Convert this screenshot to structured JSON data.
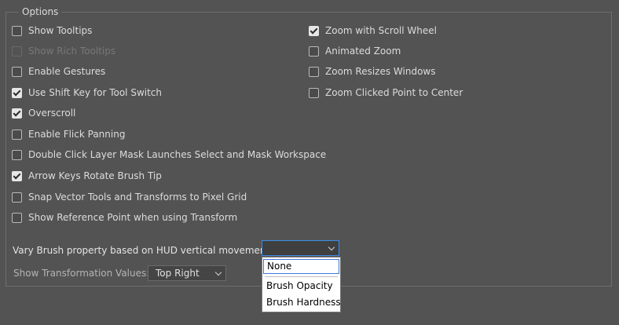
{
  "options_group": {
    "legend": "Options",
    "left_column": [
      {
        "label": "Show Tooltips",
        "checked": false,
        "disabled": false
      },
      {
        "label": "Show Rich Tooltips",
        "checked": false,
        "disabled": true
      },
      {
        "label": "Enable Gestures",
        "checked": false,
        "disabled": false
      },
      {
        "label": "Use Shift Key for Tool Switch",
        "checked": true,
        "disabled": false
      },
      {
        "label": "Overscroll",
        "checked": true,
        "disabled": false
      },
      {
        "label": "Enable Flick Panning",
        "checked": false,
        "disabled": false
      },
      {
        "label": "Double Click Layer Mask Launches Select and Mask Workspace",
        "checked": false,
        "disabled": false
      },
      {
        "label": "Arrow Keys Rotate Brush Tip",
        "checked": true,
        "disabled": false
      },
      {
        "label": "Snap Vector Tools and Transforms to Pixel Grid",
        "checked": false,
        "disabled": false
      },
      {
        "label": "Show Reference Point when using Transform",
        "checked": false,
        "disabled": false
      }
    ],
    "right_column": [
      {
        "label": "Zoom with Scroll Wheel",
        "checked": true,
        "disabled": false
      },
      {
        "label": "Animated Zoom",
        "checked": false,
        "disabled": false
      },
      {
        "label": "Zoom Resizes Windows",
        "checked": false,
        "disabled": false
      },
      {
        "label": "Zoom Clicked Point to Center",
        "checked": false,
        "disabled": false
      }
    ],
    "vary_brush": {
      "label": "Vary Brush property based on HUD vertical movement:",
      "value": "",
      "options": [
        "None",
        "Brush Opacity",
        "Brush Hardness"
      ],
      "highlighted": "None"
    },
    "transform_values": {
      "label": "Show Transformation Values:",
      "value": "Top Right"
    }
  }
}
